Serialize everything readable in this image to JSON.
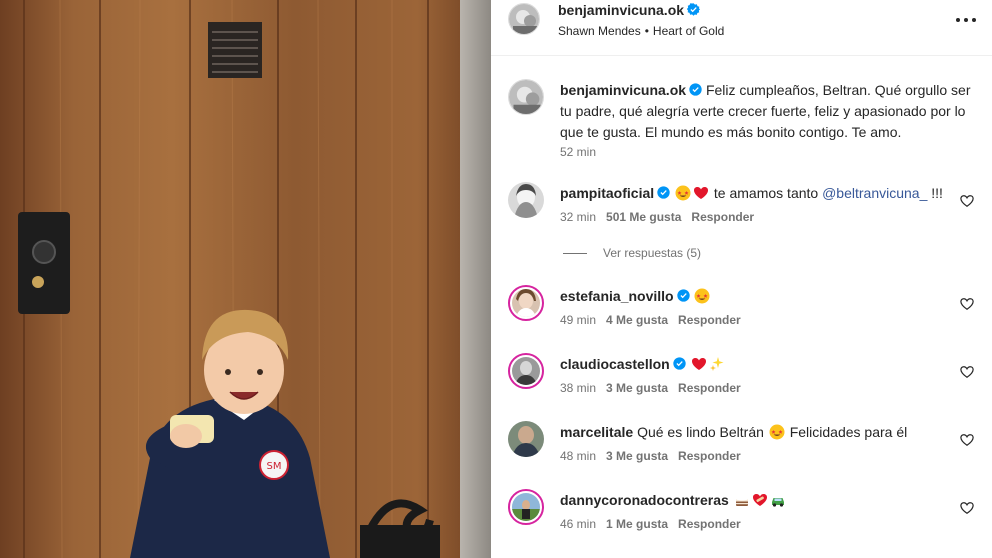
{
  "post": {
    "username": "benjaminvicuna.ok",
    "music_artist": "Shawn Mendes",
    "music_separator": "•",
    "music_song": "Heart of Gold",
    "caption_username": "benjaminvicuna.ok",
    "caption_text": "Feliz cumpleaños, Beltran. Qué orgullo ser tu padre, qué alegría verte crecer fuerte, feliz y apasionado por lo que te gusta. El mundo es más bonito contigo. Te amo.",
    "caption_time": "52 min"
  },
  "comments": [
    {
      "username": "pampitaoficial",
      "verified": true,
      "emojis": [
        "star-struck-emoji",
        "red-heart-emoji"
      ],
      "text_before": "te amamos tanto ",
      "mention": "@beltranvicuna_",
      "text_after": " !!!",
      "time": "32 min",
      "likes": "501 Me gusta",
      "reply": "Responder",
      "view_replies": "Ver respuestas (5)"
    },
    {
      "username": "estefania_novillo",
      "verified": true,
      "emojis_after": [
        "star-struck-emoji"
      ],
      "time": "49 min",
      "likes": "4 Me gusta",
      "reply": "Responder"
    },
    {
      "username": "claudiocastellon",
      "verified": true,
      "emojis_after": [
        "red-heart-emoji",
        "sparkles-emoji"
      ],
      "time": "38 min",
      "likes": "3 Me gusta",
      "reply": "Responder"
    },
    {
      "username": "marcelitale",
      "text_before": "Qué es lindo Beltrán ",
      "emojis_mid": [
        "star-struck-emoji"
      ],
      "text_after": " Felicidades para él",
      "time": "48 min",
      "likes": "3 Me gusta",
      "reply": "Responder"
    },
    {
      "username": "dannycoronadocontreras",
      "emojis_after": [
        "cake-emoji",
        "heart-bandage-emoji",
        "car-emoji"
      ],
      "time": "46 min",
      "likes": "1 Me gusta",
      "reply": "Responder"
    }
  ],
  "colors": {
    "verified_blue": "#0095f6",
    "text_primary": "#262626",
    "text_secondary": "#737373",
    "mention": "#385898",
    "story_ring": "#d6249f"
  }
}
